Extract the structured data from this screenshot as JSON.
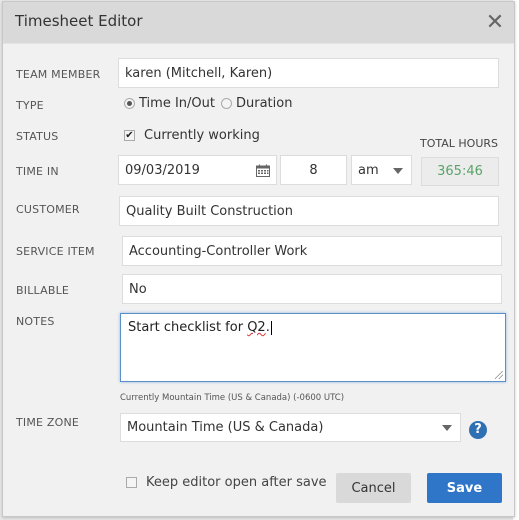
{
  "dialog": {
    "title": "Timesheet Editor",
    "close_icon": "close-icon"
  },
  "fields": {
    "team_member": {
      "label": "TEAM MEMBER",
      "value": "karen (Mitchell, Karen)"
    },
    "type": {
      "label": "TYPE",
      "options": [
        {
          "label": "Time In/Out",
          "selected": true
        },
        {
          "label": "Duration",
          "selected": false
        }
      ]
    },
    "status": {
      "label": "STATUS",
      "checkbox_label": "Currently working",
      "checked": true
    },
    "time_in": {
      "label": "TIME IN",
      "date": "09/03/2019",
      "hour": "8",
      "ampm": "am",
      "calendar_icon": "calendar-icon"
    },
    "total_hours": {
      "label": "TOTAL HOURS",
      "value": "365:46",
      "color": "#5aa469"
    },
    "customer": {
      "label": "CUSTOMER",
      "value": "Quality Built Construction"
    },
    "service_item": {
      "label": "SERVICE ITEM",
      "value": "Accounting-Controller Work"
    },
    "billable": {
      "label": "BILLABLE",
      "value": "No"
    },
    "notes": {
      "label": "NOTES",
      "text_before": "Start checklist for ",
      "text_misspelled": "Q2",
      "text_after": "."
    },
    "time_zone": {
      "label": "TIME ZONE",
      "note": "Currently Mountain Time (US & Canada) (-0600 UTC)",
      "value": "Mountain Time (US & Canada)",
      "help_icon": "question-circle-icon"
    }
  },
  "footer": {
    "keep_open_label": "Keep editor open after save",
    "keep_open_checked": false,
    "cancel_label": "Cancel",
    "save_label": "Save",
    "save_color": "#2f76c9"
  }
}
